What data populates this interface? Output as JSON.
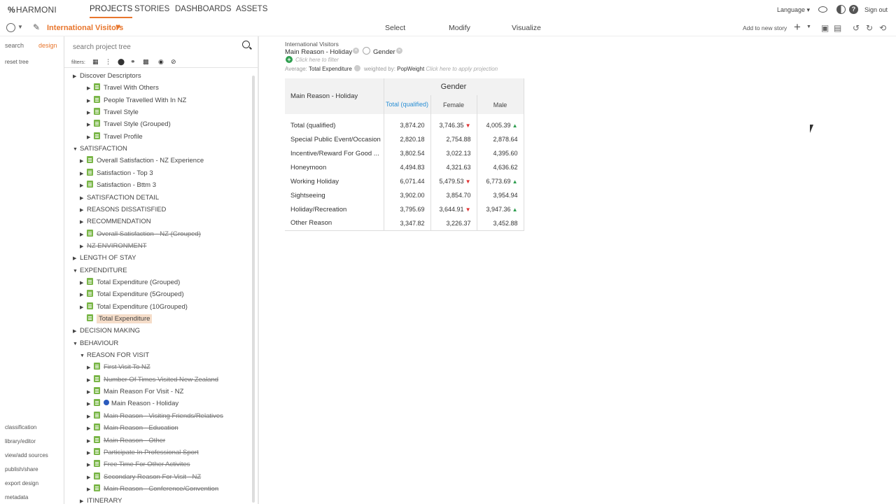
{
  "app": {
    "logo": "HARMONI",
    "nav": [
      {
        "label": "PROJECTS",
        "active": true
      },
      {
        "label": "STORIES",
        "active": false
      },
      {
        "label": "DASHBOARDS",
        "active": false
      },
      {
        "label": "ASSETS",
        "active": false
      }
    ],
    "language": "Language ▾",
    "signout": "Sign out"
  },
  "toolbar": {
    "project_title": "International Visitors",
    "modes": [
      "Select",
      "Modify",
      "Visualize"
    ],
    "add_to_story": "Add to new story"
  },
  "sidebar": {
    "tabs": {
      "search": "search",
      "design": "design"
    },
    "reset_tree": "reset tree",
    "bottom_links": [
      "classification",
      "library/editor",
      "view/add sources",
      "publish/share",
      "export design",
      "metadata"
    ]
  },
  "tree": {
    "search_placeholder": "search project tree",
    "filters_label": "filters:",
    "rows": [
      {
        "label": "Discover Descriptors",
        "level": 0,
        "arrow": "▶",
        "doc": false,
        "strike": false
      },
      {
        "label": "Travel With Others",
        "level": 2,
        "arrow": "▶",
        "doc": true,
        "strike": false
      },
      {
        "label": "People Travelled With In NZ",
        "level": 2,
        "arrow": "▶",
        "doc": true,
        "strike": false
      },
      {
        "label": "Travel Style",
        "level": 2,
        "arrow": "▶",
        "doc": true,
        "strike": false
      },
      {
        "label": "Travel Style (Grouped)",
        "level": 2,
        "arrow": "▶",
        "doc": true,
        "strike": false
      },
      {
        "label": "Travel Profile",
        "level": 2,
        "arrow": "▶",
        "doc": true,
        "strike": false
      },
      {
        "label": "SATISFACTION",
        "level": 0,
        "arrow": "▼",
        "doc": false,
        "strike": false
      },
      {
        "label": "Overall Satisfaction - NZ Experience",
        "level": 1,
        "arrow": "▶",
        "doc": true,
        "strike": false
      },
      {
        "label": "Satisfaction - Top 3",
        "level": 1,
        "arrow": "▶",
        "doc": true,
        "strike": false
      },
      {
        "label": "Satisfaction - Bttm 3",
        "level": 1,
        "arrow": "▶",
        "doc": true,
        "strike": false
      },
      {
        "label": "SATISFACTION DETAIL",
        "level": 1,
        "arrow": "▶",
        "doc": false,
        "strike": false
      },
      {
        "label": "REASONS DISSATISFIED",
        "level": 1,
        "arrow": "▶",
        "doc": false,
        "strike": false
      },
      {
        "label": "RECOMMENDATION",
        "level": 1,
        "arrow": "▶",
        "doc": false,
        "strike": false
      },
      {
        "label": "Overall Satisfaction - NZ (Grouped)",
        "level": 1,
        "arrow": "▶",
        "doc": true,
        "strike": true
      },
      {
        "label": "NZ ENVIRONMENT",
        "level": 1,
        "arrow": "▶",
        "doc": false,
        "strike": true
      },
      {
        "label": "LENGTH OF STAY",
        "level": 0,
        "arrow": "▶",
        "doc": false,
        "strike": false
      },
      {
        "label": "EXPENDITURE",
        "level": 0,
        "arrow": "▼",
        "doc": false,
        "strike": false
      },
      {
        "label": "Total Expenditure (Grouped)",
        "level": 1,
        "arrow": "▶",
        "doc": true,
        "strike": false
      },
      {
        "label": "Total Expenditure (5Grouped)",
        "level": 1,
        "arrow": "▶",
        "doc": true,
        "strike": false
      },
      {
        "label": "Total Expenditure (10Grouped)",
        "level": 1,
        "arrow": "▶",
        "doc": true,
        "strike": false
      },
      {
        "label": "Total Expenditure",
        "level": 1,
        "arrow": "",
        "doc": true,
        "strike": false,
        "selected": true
      },
      {
        "label": "DECISION MAKING",
        "level": 0,
        "arrow": "▶",
        "doc": false,
        "strike": false
      },
      {
        "label": "BEHAVIOUR",
        "level": 0,
        "arrow": "▼",
        "doc": false,
        "strike": false
      },
      {
        "label": "REASON FOR VISIT",
        "level": 1,
        "arrow": "▼",
        "doc": false,
        "strike": false
      },
      {
        "label": "First Visit To NZ",
        "level": 2,
        "arrow": "▶",
        "doc": true,
        "strike": true
      },
      {
        "label": "Number Of Times Visited New Zealand",
        "level": 2,
        "arrow": "▶",
        "doc": true,
        "strike": true
      },
      {
        "label": "Main Reason For Visit - NZ",
        "level": 2,
        "arrow": "▶",
        "doc": true,
        "strike": false
      },
      {
        "label": "Main Reason - Holiday",
        "level": 2,
        "arrow": "▶",
        "doc": true,
        "strike": false,
        "info": true
      },
      {
        "label": "Main Reason - Visiting Friends/Relatives",
        "level": 2,
        "arrow": "▶",
        "doc": true,
        "strike": true
      },
      {
        "label": "Main Reason - Education",
        "level": 2,
        "arrow": "▶",
        "doc": true,
        "strike": true
      },
      {
        "label": "Main Reason - Other",
        "level": 2,
        "arrow": "▶",
        "doc": true,
        "strike": true
      },
      {
        "label": "Participate In Professional Sport",
        "level": 2,
        "arrow": "▶",
        "doc": true,
        "strike": true
      },
      {
        "label": "Free Time For Other Activites",
        "level": 2,
        "arrow": "▶",
        "doc": true,
        "strike": true
      },
      {
        "label": "Secondary Reason For Visit - NZ",
        "level": 2,
        "arrow": "▶",
        "doc": true,
        "strike": true
      },
      {
        "label": "Main Reason - Conference/Convention",
        "level": 2,
        "arrow": "▶",
        "doc": true,
        "strike": true
      },
      {
        "label": "ITINERARY",
        "level": 1,
        "arrow": "▶",
        "doc": false,
        "strike": false
      }
    ]
  },
  "table": {
    "dataset": "International Visitors",
    "row_variable": "Main Reason - Holiday",
    "column_variable": "Gender",
    "filter_hint": "Click here to filter",
    "measure_prefix": "Average:",
    "measure": "Total Expenditure",
    "weighted_prefix": "weighted by:",
    "weight": "PopWeight",
    "projection_hint": "Click here to apply projection",
    "col_group": "Gender",
    "columns": [
      "Total (qualified)",
      "Female",
      "Male"
    ],
    "rows": [
      {
        "label": "Total (qualified)",
        "values": [
          "3,874.20",
          "3,746.35",
          "4,005.39"
        ],
        "marks": [
          "",
          "down",
          "up"
        ]
      },
      {
        "label": "Special Public Event/Occasion",
        "values": [
          "2,820.18",
          "2,754.88",
          "2,878.64"
        ],
        "marks": [
          "",
          "",
          ""
        ]
      },
      {
        "label": "Incentive/Reward For Good ...",
        "values": [
          "3,802.54",
          "3,022.13",
          "4,395.60"
        ],
        "marks": [
          "",
          "",
          ""
        ]
      },
      {
        "label": "Honeymoon",
        "values": [
          "4,494.83",
          "4,321.63",
          "4,636.62"
        ],
        "marks": [
          "",
          "",
          ""
        ]
      },
      {
        "label": "Working Holiday",
        "values": [
          "6,071.44",
          "5,479.53",
          "6,773.69"
        ],
        "marks": [
          "",
          "down",
          "up"
        ]
      },
      {
        "label": "Sightseeing",
        "values": [
          "3,902.00",
          "3,854.70",
          "3,954.94"
        ],
        "marks": [
          "",
          "",
          ""
        ]
      },
      {
        "label": "Holiday/Recreation",
        "values": [
          "3,795.69",
          "3,644.91",
          "3,947.36"
        ],
        "marks": [
          "",
          "down",
          "up"
        ]
      },
      {
        "label": "Other Reason",
        "values": [
          "3,347.82",
          "3,226.37",
          "3,452.88"
        ],
        "marks": [
          "",
          "",
          ""
        ]
      }
    ]
  }
}
